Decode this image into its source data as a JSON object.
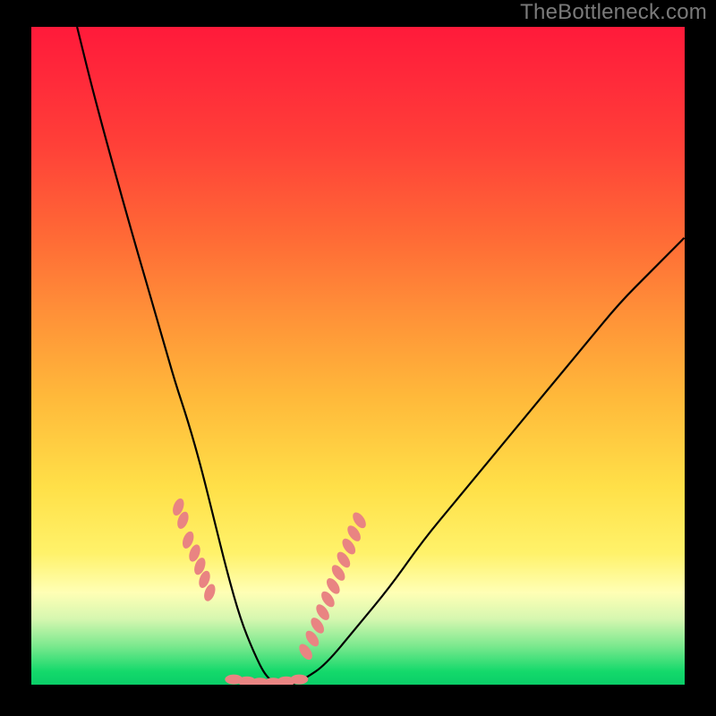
{
  "watermark": "TheBottleneck.com",
  "chart_data": {
    "type": "line",
    "title": "",
    "xlabel": "",
    "ylabel": "",
    "xlim": [
      0,
      100
    ],
    "ylim": [
      0,
      100
    ],
    "gradient_note": "Background is a vertical gradient from red (top, high bottleneck) through orange/yellow to green (bottom, no bottleneck). Curve depicts bottleneck percentage vs. some hardware parameter, forming a V shape with minimum near the ideal match.",
    "series": [
      {
        "name": "bottleneck-curve",
        "x": [
          7,
          10,
          15,
          20,
          22,
          24,
          26,
          28,
          30,
          32,
          34,
          36,
          38,
          40,
          42,
          45,
          50,
          55,
          60,
          65,
          70,
          75,
          80,
          85,
          90,
          95,
          100
        ],
        "y": [
          100,
          88,
          70,
          53,
          46,
          40,
          33,
          25,
          17,
          10,
          5,
          1,
          0,
          0,
          1,
          3,
          9,
          15,
          22,
          28,
          34,
          40,
          46,
          52,
          58,
          63,
          68
        ]
      }
    ],
    "left_marker_cluster": {
      "name": "left-hardware-points",
      "color": "#e98482",
      "points": [
        {
          "x": 22.5,
          "y": 27
        },
        {
          "x": 23.2,
          "y": 25
        },
        {
          "x": 24.0,
          "y": 22
        },
        {
          "x": 25.0,
          "y": 20
        },
        {
          "x": 25.8,
          "y": 18
        },
        {
          "x": 26.5,
          "y": 16
        },
        {
          "x": 27.3,
          "y": 14
        }
      ]
    },
    "right_marker_cluster": {
      "name": "right-hardware-points",
      "color": "#e98482",
      "points": [
        {
          "x": 42.0,
          "y": 5
        },
        {
          "x": 43.0,
          "y": 7
        },
        {
          "x": 43.8,
          "y": 9
        },
        {
          "x": 44.6,
          "y": 11
        },
        {
          "x": 45.4,
          "y": 13
        },
        {
          "x": 46.2,
          "y": 15
        },
        {
          "x": 47.0,
          "y": 17
        },
        {
          "x": 47.8,
          "y": 19
        },
        {
          "x": 48.6,
          "y": 21
        },
        {
          "x": 49.4,
          "y": 23
        },
        {
          "x": 50.2,
          "y": 25
        }
      ]
    },
    "bottom_marker_cluster": {
      "name": "bottom-hardware-points",
      "color": "#e98482",
      "points": [
        {
          "x": 31.0,
          "y": 0.8
        },
        {
          "x": 33.0,
          "y": 0.5
        },
        {
          "x": 35.0,
          "y": 0.3
        },
        {
          "x": 37.0,
          "y": 0.3
        },
        {
          "x": 39.0,
          "y": 0.5
        },
        {
          "x": 41.0,
          "y": 0.8
        }
      ]
    }
  }
}
